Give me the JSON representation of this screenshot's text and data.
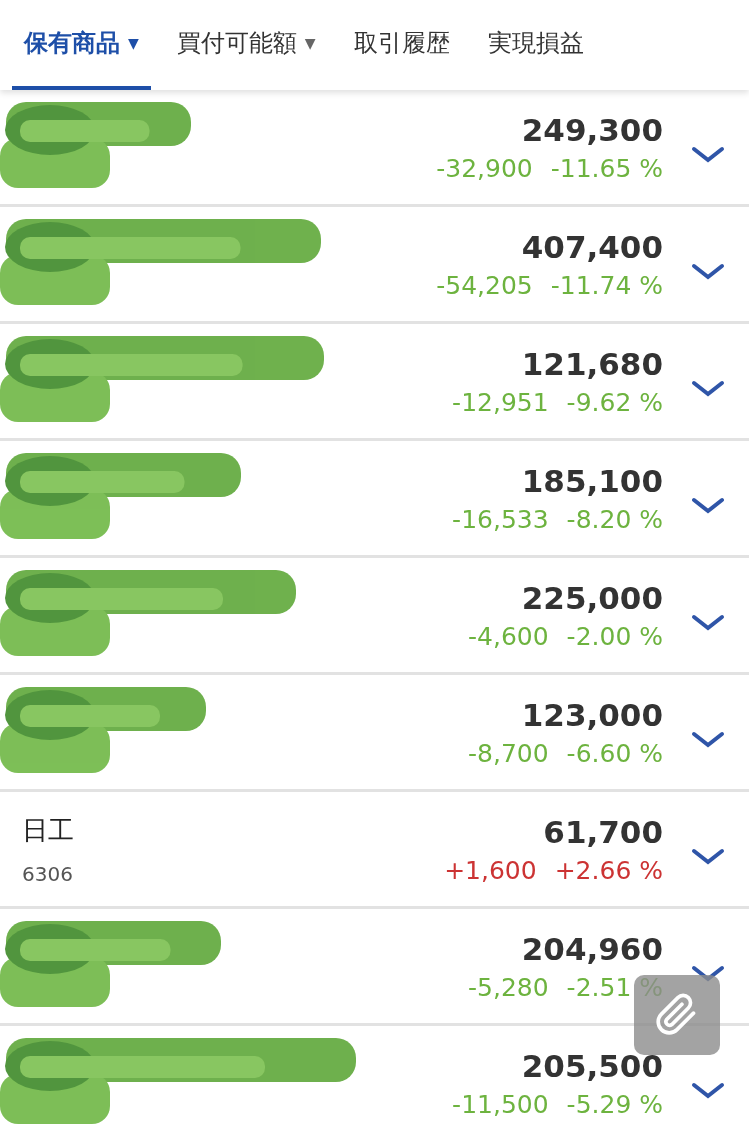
{
  "tabs": [
    {
      "label": "保有商品",
      "caret": "▼",
      "selected": true
    },
    {
      "label": "買付可能額",
      "caret": "▼",
      "selected": false
    },
    {
      "label": "取引履歴",
      "selected": false
    },
    {
      "label": "実現損益",
      "selected": false
    }
  ],
  "holdings": [
    {
      "redacted": true,
      "value": "249,300",
      "change": "-32,900",
      "percent": "-11.65 %",
      "color": "#6db33f"
    },
    {
      "redacted": true,
      "value": "407,400",
      "change": "-54,205",
      "percent": "-11.74 %",
      "color": "#6db33f"
    },
    {
      "redacted": true,
      "value": "121,680",
      "change": "-12,951",
      "percent": "-9.62 %",
      "color": "#6db33f"
    },
    {
      "redacted": true,
      "value": "185,100",
      "change": "-16,533",
      "percent": "-8.20 %",
      "color": "#6db33f"
    },
    {
      "redacted": true,
      "value": "225,000",
      "change": "-4,600",
      "percent": "-2.00 %",
      "color": "#6db33f"
    },
    {
      "redacted": true,
      "value": "123,000",
      "change": "-8,700",
      "percent": "-6.60 %",
      "color": "#6db33f"
    },
    {
      "redacted": false,
      "name": "日工",
      "code": "6306",
      "value": "61,700",
      "change": "+1,600",
      "percent": "+2.66 %",
      "color": "#cc3333"
    },
    {
      "redacted": true,
      "value": "204,960",
      "change": "-5,280",
      "percent": "-2.51 %",
      "color": "#6db33f"
    },
    {
      "redacted": true,
      "value": "205,500",
      "change": "-11,500",
      "percent": "-5.29 %",
      "color": "#6db33f"
    }
  ]
}
